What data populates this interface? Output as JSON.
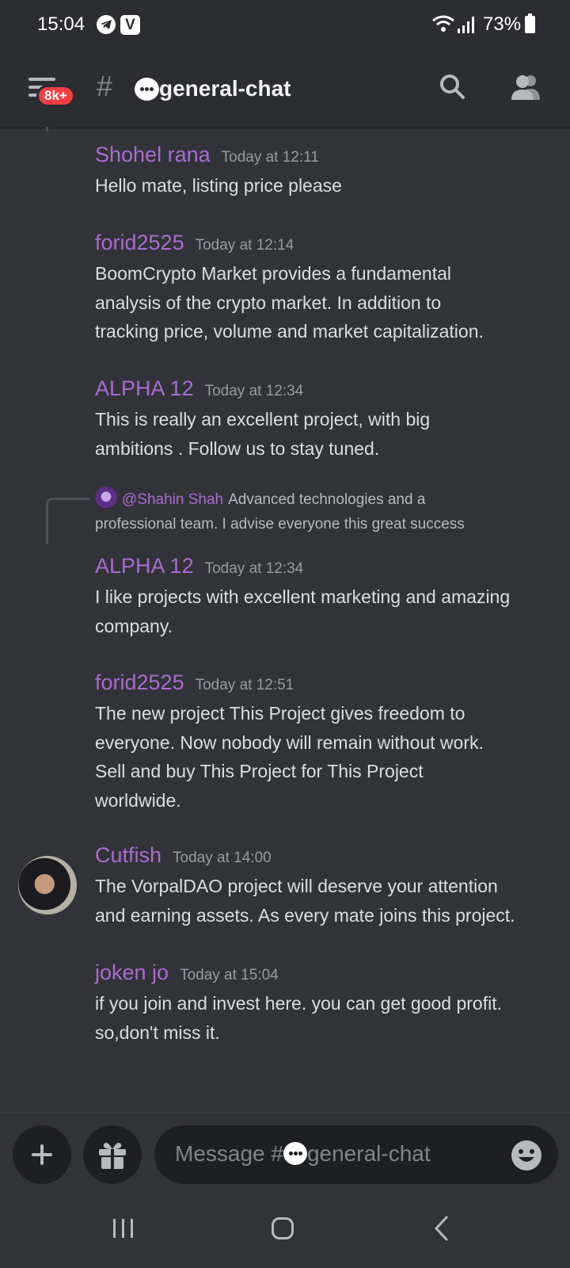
{
  "status_bar": {
    "time": "15:04",
    "battery": "73%",
    "icons": [
      "telegram-icon",
      "v-app-icon",
      "wifi-icon",
      "signal-icon",
      "battery-icon"
    ]
  },
  "header": {
    "badge": "8k+",
    "hash": "#",
    "channel_name": "general-chat",
    "icons": [
      "menu-icon",
      "speech-bubble-emoji",
      "search-icon",
      "members-icon"
    ]
  },
  "messages": [
    {
      "author": "Shohel rana",
      "time": "Today at 12:11",
      "lines": [
        "Hello mate,  listing price please"
      ]
    },
    {
      "author": "forid2525",
      "time": "Today at 12:14",
      "lines": [
        "BoomCrypto Market provides a fundamental",
        "analysis of the crypto market. In addition to",
        "tracking price, volume and market capitalization."
      ]
    },
    {
      "author": "ALPHA 12",
      "time": "Today at 12:34",
      "lines": [
        "This is really an excellent project, with big",
        "ambitions . Follow us to stay tuned."
      ]
    },
    {
      "author": "ALPHA 12",
      "time": "Today at 12:34",
      "lines": [
        "I like projects with excellent marketing and amazing",
        "company."
      ]
    },
    {
      "author": "forid2525",
      "time": "Today at 12:51",
      "lines": [
        "The new project This Project gives freedom to",
        "everyone. Now nobody will remain without work.",
        "Sell and buy This Project for This Project",
        "worldwide."
      ]
    },
    {
      "author": "Cutfish",
      "time": "Today at 14:00",
      "lines": [
        "The VorpalDAO project will deserve your attention",
        "and earning assets. As every mate joins this project."
      ]
    },
    {
      "author": "joken  jo",
      "time": "Today at 15:04",
      "lines": [
        "if you join and invest here. you can get good profit.",
        "so,don't miss it."
      ]
    }
  ],
  "reply": {
    "author": "@Shahin Shah",
    "line1": "Advanced technologies and a",
    "line2": "professional team. I advise everyone this great success"
  },
  "composer": {
    "placeholder_prefix": "Message #",
    "placeholder_channel": "general-chat",
    "icons": [
      "plus-icon",
      "gift-icon",
      "emoji-icon"
    ]
  },
  "nav_bar": {
    "icons": [
      "recent-apps-icon",
      "home-icon",
      "back-icon"
    ]
  },
  "colors": {
    "background": "#313338",
    "header": "#2b2d31",
    "username": "#a96bd1",
    "badge": "#f23f43"
  }
}
